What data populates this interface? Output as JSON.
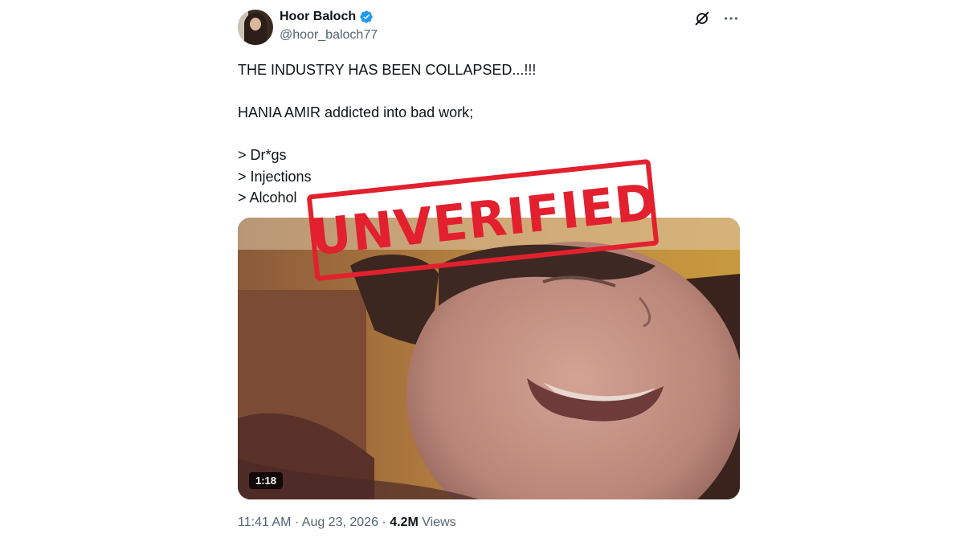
{
  "author": {
    "display_name": "Hoor Baloch",
    "handle": "@hoor_baloch77",
    "verified": true,
    "verified_color": "#1d9bf0"
  },
  "tweet": {
    "lines": [
      "THE INDUSTRY HAS BEEN COLLAPSED...!!!",
      "",
      "HANIA AMIR addicted into bad work;",
      "",
      "> Dr*gs",
      "> Injections",
      "> Alcohol"
    ]
  },
  "media": {
    "duration": "1:18"
  },
  "stamp": {
    "text": "UNVERIFIED",
    "color": "#e2202e"
  },
  "meta": {
    "time": "11:41 AM",
    "separator": "·",
    "date": "Aug 23, 2026",
    "views_count": "4.2M",
    "views_label": "Views"
  },
  "icons": {
    "grok": "grok-icon",
    "more": "more-icon"
  }
}
